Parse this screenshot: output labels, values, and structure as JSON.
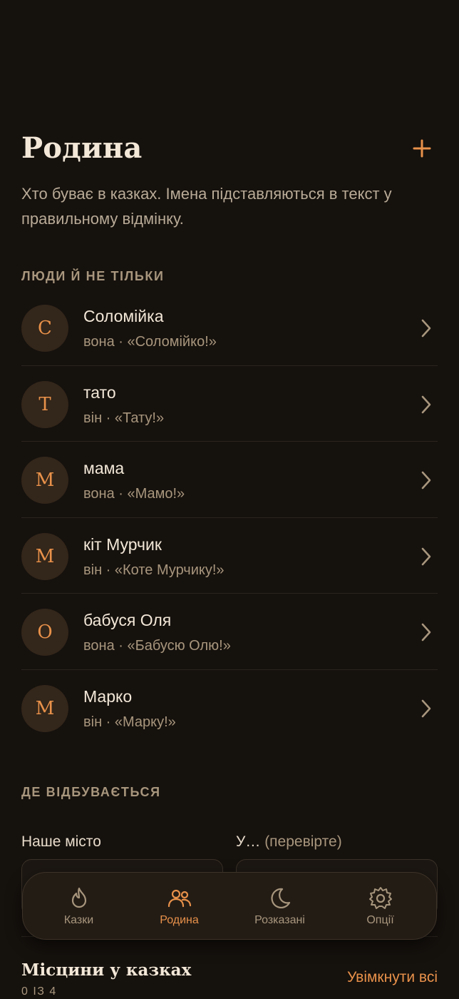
{
  "header": {
    "title": "Родина",
    "add_label": "+"
  },
  "subtitle": "Хто буває в казках. Імена підставляються в текст у правильному відмінку.",
  "people_section": {
    "label": "ЛЮДИ Й НЕ ТІЛЬКИ",
    "items": [
      {
        "initial": "С",
        "name": "Соломійка",
        "meta": "вона · «Соломійко!»"
      },
      {
        "initial": "Т",
        "name": "тато",
        "meta": "він · «Тату!»"
      },
      {
        "initial": "М",
        "name": "мама",
        "meta": "вона · «Мамо!»"
      },
      {
        "initial": "М",
        "name": "кіт Мурчик",
        "meta": "він · «Коте Мурчику!»"
      },
      {
        "initial": "О",
        "name": "бабуся Оля",
        "meta": "вона · «Бабусю Олю!»"
      },
      {
        "initial": "М",
        "name": "Марко",
        "meta": "він · «Марку!»"
      }
    ]
  },
  "place_section": {
    "label": "ДЕ ВІДБУВАЄТЬСЯ",
    "city_label": "Наше місто",
    "case_label": "У…",
    "case_hint": "(перевірте)",
    "city_value": "",
    "case_value": ""
  },
  "nav": {
    "items": [
      {
        "label": "Казки",
        "icon": "flame-icon",
        "active": false
      },
      {
        "label": "Родина",
        "icon": "people-icon",
        "active": true
      },
      {
        "label": "Розказані",
        "icon": "moon-icon",
        "active": false
      },
      {
        "label": "Опції",
        "icon": "gear-icon",
        "active": false
      }
    ]
  },
  "locations": {
    "title": "Місцини у казках",
    "count": "0 ІЗ 4",
    "action": "Увімкнути всі"
  },
  "colors": {
    "accent": "#e8914a",
    "background": "#15110d",
    "text": "#f3e8d8",
    "muted": "#a8967d"
  }
}
